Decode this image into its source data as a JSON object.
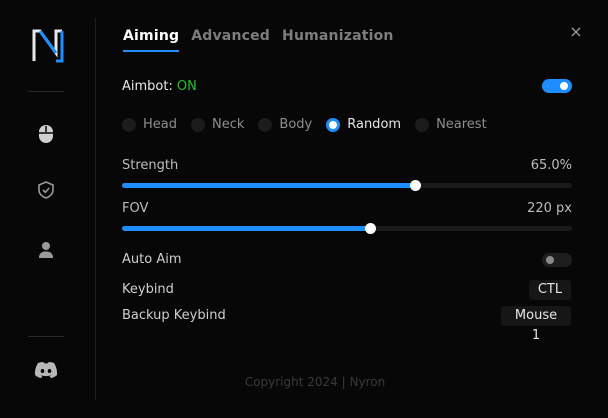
{
  "brand": {
    "logo_icon": "nyron-logo"
  },
  "sidebar": {
    "items": [
      {
        "icon": "mouse-icon"
      },
      {
        "icon": "shield-icon"
      },
      {
        "icon": "user-icon"
      }
    ],
    "bottom_icon": "discord-icon"
  },
  "tabs": [
    {
      "label": "Aiming",
      "active": true
    },
    {
      "label": "Advanced",
      "active": false
    },
    {
      "label": "Humanization",
      "active": false
    }
  ],
  "close_icon": "×",
  "aimbot": {
    "label": "Aimbot:",
    "status": "ON",
    "enabled": true
  },
  "targets": {
    "options": [
      "Head",
      "Neck",
      "Body",
      "Random",
      "Nearest"
    ],
    "selected": "Random"
  },
  "strength": {
    "label": "Strength",
    "value_text": "65.0%",
    "value": 65.0
  },
  "fov": {
    "label": "FOV",
    "value_text": "220 px",
    "fraction": 0.55
  },
  "auto_aim": {
    "label": "Auto Aim",
    "enabled": false
  },
  "keybind": {
    "label": "Keybind",
    "value": "CTL"
  },
  "backup_keybind": {
    "label": "Backup Keybind",
    "value": "Mouse 1"
  },
  "footer": {
    "text": "Copyright 2024 | Nyron"
  },
  "colors": {
    "accent": "#1e8dff",
    "on_status": "#22c32e",
    "background": "#070707"
  }
}
